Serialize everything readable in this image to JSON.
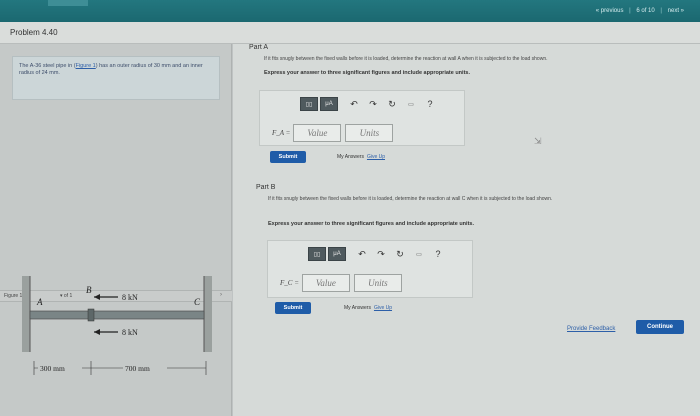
{
  "topnav": {
    "previous": "« previous",
    "sep": "|",
    "counter": "6 of 10",
    "next": "next »"
  },
  "problem": {
    "title": "Problem 4.40",
    "text_before": "The A-36 steel pipe in (",
    "figure_link": "Figure 1",
    "text_after": ") has an outer radius of 30 mm and an inner radius of 24 mm."
  },
  "figure_bar": {
    "label": "Figure 1",
    "selector": "▾ of 1",
    "nav": "‹ ›"
  },
  "figure": {
    "point_a": "A",
    "point_b": "B",
    "point_c": "C",
    "force_top": "8 kN",
    "force_bottom": "8 kN",
    "dim_left": "300 mm",
    "dim_right": "700 mm"
  },
  "part_a": {
    "label": "Part A",
    "question": "If it fits snugly between the fixed walls before it is loaded, determine the reaction at wall A when it is subjected to the load shown.",
    "instruction": "Express your answer to three significant figures and include appropriate units.",
    "var_label": "F_A =",
    "value_placeholder": "Value",
    "units_placeholder": "Units",
    "submit": "Submit",
    "my_answers": "My Answers",
    "give_up": "Give Up"
  },
  "part_b": {
    "label": "Part B",
    "question": "If it fits snugly between the fixed walls before it is loaded, determine the reaction at wall C when it is subjected to the load shown.",
    "instruction": "Express your answer to three significant figures and include appropriate units.",
    "var_label": "F_C =",
    "value_placeholder": "Value",
    "units_placeholder": "Units",
    "submit": "Submit",
    "my_answers": "My Answers",
    "give_up": "Give Up"
  },
  "toolbar": {
    "template_btn": "▯▯",
    "mu_btn": "μA",
    "undo": "↶",
    "redo": "↷",
    "reset": "↻",
    "keyboard": "▭",
    "help": "?"
  },
  "footer": {
    "feedback": "Provide Feedback",
    "continue": "Continue"
  },
  "colors": {
    "accent": "#1f5ca8",
    "header": "#1b6870"
  }
}
